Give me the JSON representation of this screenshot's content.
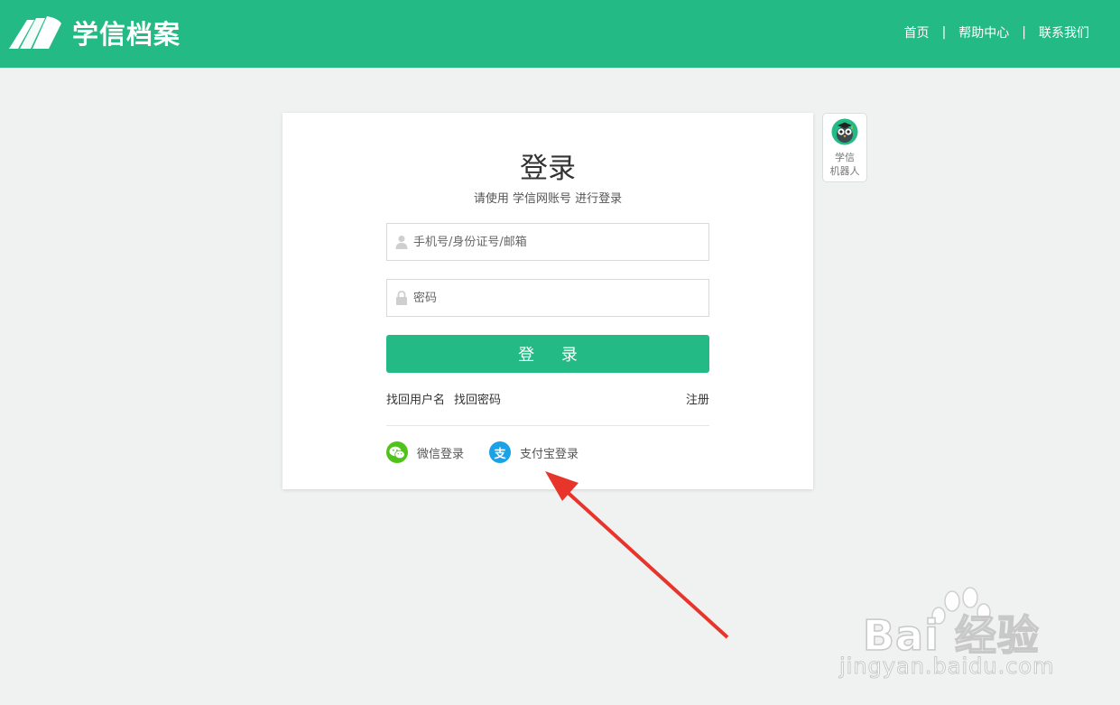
{
  "header": {
    "logo_text": "学信档案",
    "nav": [
      "首页",
      "帮助中心",
      "联系我们"
    ],
    "separator": "|"
  },
  "login": {
    "title": "登录",
    "subtitle": "请使用 学信网账号 进行登录",
    "username_placeholder": "手机号/身份证号/邮箱",
    "password_placeholder": "密码",
    "submit_label": "登 录",
    "find_username": "找回用户名",
    "find_password": "找回密码",
    "register": "注册",
    "wechat_login": "微信登录",
    "alipay_login": "支付宝登录",
    "alipay_icon_char": "支"
  },
  "robot": {
    "line1": "学信",
    "line2": "机器人"
  },
  "watermark": {
    "brand": "Bai  经验",
    "url": "jingyan.baidu.com"
  },
  "colors": {
    "brand_green": "#24ba86",
    "wechat_green": "#4fc31c",
    "alipay_blue": "#1aa1e6",
    "annotation_red": "#e8352b"
  },
  "icons": {
    "logo": "book-pages-icon",
    "user": "user-icon",
    "lock": "lock-icon",
    "wechat": "wechat-icon",
    "alipay": "alipay-icon",
    "robot": "robot-avatar-icon",
    "arrow": "red-arrow-annotation"
  }
}
